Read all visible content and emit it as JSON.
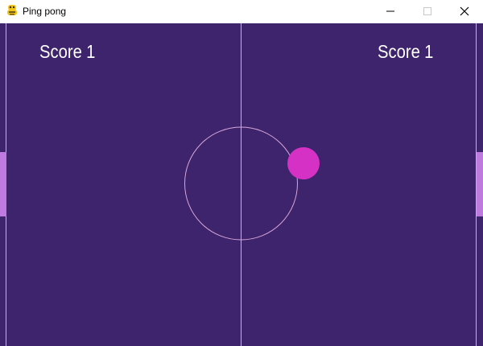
{
  "window": {
    "title": "Ping pong",
    "icon": "python-snake-icon",
    "buttons": {
      "minimize": "minimize-icon",
      "maximize": "maximize-icon",
      "close": "close-icon"
    }
  },
  "game": {
    "colors": {
      "background": "#3d246c",
      "lines": "#d8a6d8",
      "ball": "#d631c5",
      "paddle": "#bf7ae0",
      "text": "#ffffff"
    },
    "left_player": {
      "score_label": "Score",
      "score_value": "1"
    },
    "right_player": {
      "score_label": "Score",
      "score_value": "1"
    }
  }
}
